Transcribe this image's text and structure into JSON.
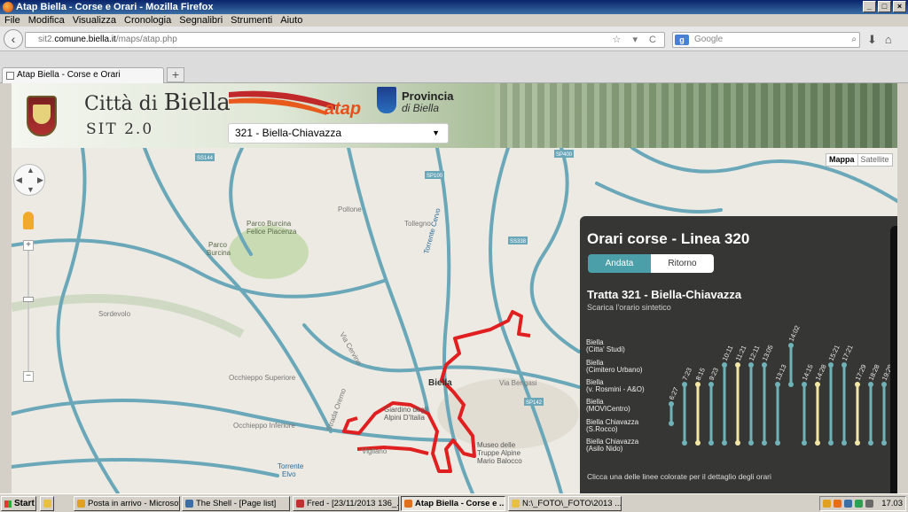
{
  "window": {
    "title": "Atap Biella - Corse e Orari - Mozilla Firefox",
    "buttons": [
      "_",
      "□",
      "×"
    ]
  },
  "menu": [
    "File",
    "Modifica",
    "Visualizza",
    "Cronologia",
    "Segnalibri",
    "Strumenti",
    "Aiuto"
  ],
  "nav": {
    "url_prefix": "sit2.",
    "url_domain": "comune.biella.it",
    "url_path": "/maps/atap.php",
    "search_engine_glyph": "g",
    "search_placeholder": "Google",
    "url_controls": "☆ ▾ C",
    "icons": [
      "back-arrow-icon",
      "star-icon",
      "reload-icon",
      "download-icon",
      "home-icon"
    ]
  },
  "tab": {
    "title": "Atap Biella - Corse e Orari",
    "new_tab_glyph": "+"
  },
  "header": {
    "citta_prefix": "Città di ",
    "citta_name": "Biella",
    "sit": "SIT 2.0",
    "atap_logo": "atap",
    "provincia_l1": "Provincia",
    "provincia_l2": "di Biella"
  },
  "route_select": {
    "value": "321 - Biella-Chiavazza"
  },
  "map": {
    "toggle": {
      "map": "Mappa",
      "satellite": "Satellite"
    },
    "labels": [
      {
        "t": "Parco Burcina",
        "c": "#5a6a4a"
      },
      {
        "t": "Felice Piacenza",
        "c": "#5a6a4a"
      },
      {
        "t": "Parco",
        "c": "#5a6a4a"
      },
      {
        "t": "Burcina",
        "c": "#5a6a4a"
      },
      {
        "t": "Biella",
        "c": "#333"
      },
      {
        "t": "Giardino degli",
        "c": "#555"
      },
      {
        "t": "Alpini D'Italia",
        "c": "#555"
      },
      {
        "t": "Museo delle",
        "c": "#555"
      },
      {
        "t": "Truppe Alpine",
        "c": "#555"
      },
      {
        "t": "Mario Balocco",
        "c": "#555"
      },
      {
        "t": "Torrente",
        "c": "#2a6a9a"
      },
      {
        "t": "Elvo",
        "c": "#2a6a9a"
      },
      {
        "t": "SS144",
        "c": "#fff"
      },
      {
        "t": "SP100",
        "c": "#fff"
      },
      {
        "t": "SP142",
        "c": "#fff"
      },
      {
        "t": "SS338",
        "c": "#fff"
      },
      {
        "t": "SP400",
        "c": "#fff"
      },
      {
        "t": "Tollegno",
        "c": "#777"
      },
      {
        "t": "Pollone",
        "c": "#777"
      },
      {
        "t": "Sordevolo",
        "c": "#777"
      },
      {
        "t": "Occhieppo Superiore",
        "c": "#777"
      },
      {
        "t": "Occhieppo Inferiore",
        "c": "#777"
      },
      {
        "t": "Via Bengasi",
        "c": "#777"
      },
      {
        "t": "Via Cervino",
        "c": "#777"
      },
      {
        "t": "Torrente Cervo",
        "c": "#2a6a9a"
      },
      {
        "t": "Strada Oremo",
        "c": "#777"
      },
      {
        "t": "Vigliano",
        "c": "#777"
      }
    ]
  },
  "panel": {
    "title": "Orari corse - Linea 320",
    "tab_andata": "Andata",
    "tab_ritorno": "Ritorno",
    "tratta": "Tratta 321 - Biella-Chiavazza",
    "scarica": "Scarica l'orario sintetico",
    "footer": "Clicca una delle linee colorate per il dettaglio degli orari",
    "stops": [
      {
        "l1": "Biella",
        "l2": "(Citta' Studi)"
      },
      {
        "l1": "Biella",
        "l2": "(Cimitero Urbano)"
      },
      {
        "l1": "Biella",
        "l2": "(v. Rosmini - A&O)"
      },
      {
        "l1": "Biella",
        "l2": "(MOVICentro)"
      },
      {
        "l1": "Biella Chiavazza",
        "l2": "(S.Rocco)"
      },
      {
        "l1": "Biella Chiavazza",
        "l2": "(Asilo Nido)"
      }
    ],
    "runs": [
      {
        "time": "6:27",
        "first": 3,
        "last": 4,
        "color": "#6fb3b8"
      },
      {
        "time": "7:23",
        "first": 2,
        "last": 5,
        "color": "#6fb3b8"
      },
      {
        "time": "8:15",
        "first": 2,
        "last": 5,
        "color": "#f3e7a6"
      },
      {
        "time": "9:23",
        "first": 2,
        "last": 5,
        "color": "#6fb3b8"
      },
      {
        "time": "10:11",
        "first": 1,
        "last": 5,
        "color": "#6fb3b8"
      },
      {
        "time": "11:21",
        "first": 1,
        "last": 5,
        "color": "#f3e7a6"
      },
      {
        "time": "12:11",
        "first": 1,
        "last": 5,
        "color": "#6fb3b8"
      },
      {
        "time": "13:05",
        "first": 1,
        "last": 5,
        "color": "#6fb3b8"
      },
      {
        "time": "13:13",
        "first": 2,
        "last": 5,
        "color": "#6fb3b8"
      },
      {
        "time": "14:02",
        "first": 0,
        "last": 2,
        "color": "#6fb3b8"
      },
      {
        "time": "14:15",
        "first": 2,
        "last": 5,
        "color": "#6fb3b8"
      },
      {
        "time": "14:28",
        "first": 2,
        "last": 5,
        "color": "#f3e7a6"
      },
      {
        "time": "15:21",
        "first": 1,
        "last": 5,
        "color": "#6fb3b8"
      },
      {
        "time": "17:21",
        "first": 1,
        "last": 5,
        "color": "#6fb3b8"
      },
      {
        "time": "17:29",
        "first": 2,
        "last": 5,
        "color": "#f3e7a6"
      },
      {
        "time": "18:28",
        "first": 2,
        "last": 5,
        "color": "#6fb3b8"
      },
      {
        "time": "19:29",
        "first": 2,
        "last": 5,
        "color": "#6fb3b8"
      }
    ]
  },
  "taskbar": {
    "start": "Start",
    "items": [
      {
        "label": "Posta in arrivo - Microsof...",
        "color": "#e0a020",
        "active": false
      },
      {
        "label": "The Shell - [Page list]",
        "color": "#3a6ea5",
        "active": false
      },
      {
        "label": "Fred - [23/11/2013 136_...",
        "color": "#c03030",
        "active": false
      },
      {
        "label": "Atap Biella - Corse e ...",
        "color": "#e0701c",
        "active": true
      },
      {
        "label": "N:\\_FOTO\\_FOTO\\2013 ...",
        "color": "#e8c040",
        "active": false
      }
    ],
    "clock": "17.03"
  }
}
